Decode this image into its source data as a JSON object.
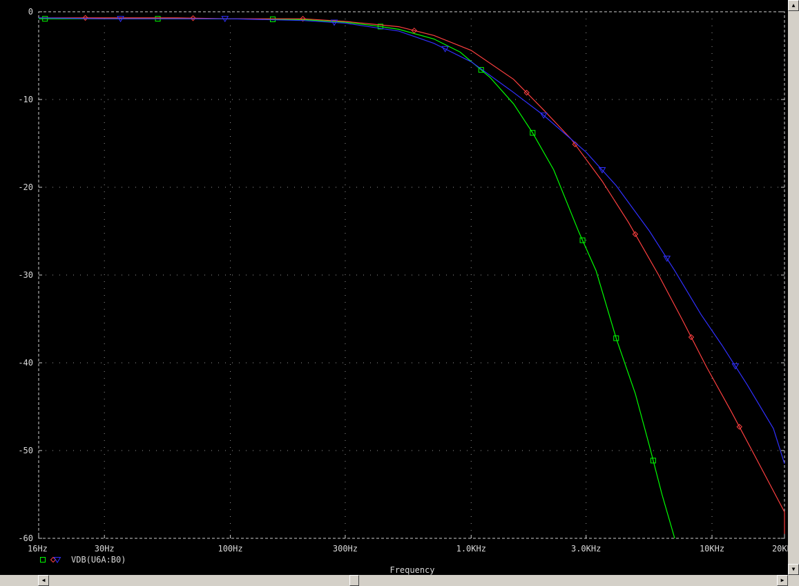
{
  "chart_data": {
    "type": "line",
    "xscale": "log",
    "xlim": [
      16,
      20000
    ],
    "ylim": [
      -60,
      0
    ],
    "xlabel": "Frequency",
    "ylabel": "",
    "x_ticks": [
      16,
      30,
      100,
      300,
      1000,
      3000,
      10000,
      20000
    ],
    "x_tick_labels": [
      "16Hz",
      "30Hz",
      "100Hz",
      "300Hz",
      "1.0KHz",
      "3.0KHz",
      "10KHz",
      "20KHz"
    ],
    "y_ticks": [
      0,
      -10,
      -20,
      -30,
      -40,
      -50,
      -60
    ],
    "y_tick_labels": [
      "0",
      "-10",
      "-20",
      "-30",
      "-40",
      "-50",
      "-60"
    ],
    "grid": true,
    "legend_position": "bottom-left",
    "legend_text": "VDB(U6A:B0)",
    "series": [
      {
        "color": "#00ff00",
        "marker": "square",
        "points": [
          [
            16,
            -0.8
          ],
          [
            30,
            -0.8
          ],
          [
            60,
            -0.8
          ],
          [
            100,
            -0.8
          ],
          [
            200,
            -0.9
          ],
          [
            300,
            -1.2
          ],
          [
            400,
            -1.6
          ],
          [
            500,
            -2.0
          ],
          [
            700,
            -3.1
          ],
          [
            900,
            -4.6
          ],
          [
            1200,
            -7.5
          ],
          [
            1500,
            -10.5
          ],
          [
            1800,
            -13.8
          ],
          [
            2200,
            -18.0
          ],
          [
            2800,
            -25.1
          ],
          [
            3300,
            -29.5
          ],
          [
            4000,
            -37.2
          ],
          [
            4800,
            -43.5
          ],
          [
            5500,
            -49.5
          ],
          [
            6200,
            -55.0
          ],
          [
            7000,
            -60.0
          ]
        ],
        "markers_x": [
          17,
          50,
          150,
          420,
          1100,
          1800,
          2900,
          4000,
          5700
        ]
      },
      {
        "color": "#ff4040",
        "marker": "diamond",
        "points": [
          [
            16,
            -0.7
          ],
          [
            30,
            -0.7
          ],
          [
            60,
            -0.7
          ],
          [
            100,
            -0.8
          ],
          [
            200,
            -0.8
          ],
          [
            300,
            -1.1
          ],
          [
            500,
            -1.7
          ],
          [
            700,
            -2.7
          ],
          [
            1000,
            -4.4
          ],
          [
            1500,
            -7.7
          ],
          [
            2000,
            -11.2
          ],
          [
            2600,
            -14.5
          ],
          [
            3500,
            -19.3
          ],
          [
            4500,
            -24.0
          ],
          [
            6000,
            -30.0
          ],
          [
            7500,
            -35.0
          ],
          [
            9500,
            -40.5
          ],
          [
            12000,
            -45.5
          ],
          [
            15000,
            -50.5
          ],
          [
            20000,
            -57.0
          ],
          [
            21000,
            -59.5
          ]
        ],
        "markers_x": [
          25,
          70,
          200,
          580,
          1700,
          2700,
          4800,
          8200,
          13000,
          22000
        ]
      },
      {
        "color": "#3030ff",
        "marker": "triangle",
        "points": [
          [
            16,
            -0.7
          ],
          [
            30,
            -0.8
          ],
          [
            60,
            -0.8
          ],
          [
            100,
            -0.8
          ],
          [
            200,
            -1.0
          ],
          [
            300,
            -1.3
          ],
          [
            500,
            -2.2
          ],
          [
            700,
            -3.6
          ],
          [
            1000,
            -5.7
          ],
          [
            1500,
            -9.2
          ],
          [
            2000,
            -11.8
          ],
          [
            3000,
            -16.0
          ],
          [
            4000,
            -19.8
          ],
          [
            5500,
            -25.0
          ],
          [
            7000,
            -29.5
          ],
          [
            9000,
            -34.5
          ],
          [
            11000,
            -38.0
          ],
          [
            14000,
            -42.5
          ],
          [
            18000,
            -47.5
          ],
          [
            22000,
            -51.5
          ]
        ],
        "markers_x": [
          35,
          95,
          270,
          780,
          2000,
          3500,
          6500,
          12500,
          20500
        ]
      }
    ]
  },
  "status": {
    "xaxis_title": "Frequency"
  },
  "scrollbars": {
    "up_arrow": "▲",
    "down_arrow": "▼",
    "left_arrow": "◀",
    "right_arrow": "▶"
  }
}
